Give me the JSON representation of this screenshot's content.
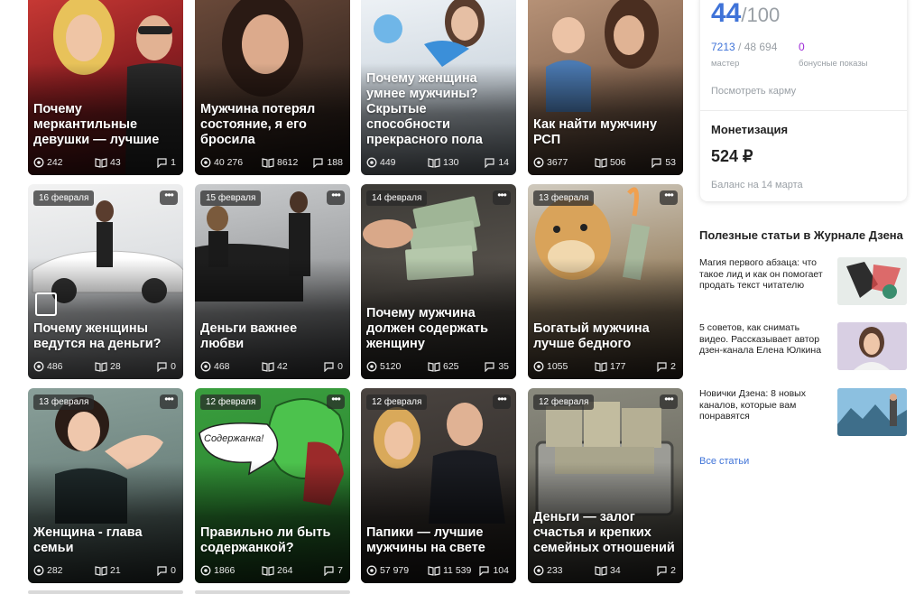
{
  "cards": [
    {
      "date": "",
      "title": "Почему меркантильные девушки — лучшие",
      "views": "242",
      "reads": "43",
      "comments": "1"
    },
    {
      "date": "",
      "title": "Мужчина потерял состояние, я его бросила",
      "views": "40 276",
      "reads": "8612",
      "comments": "188"
    },
    {
      "date": "",
      "title": "Почему женщина умнее мужчины? Скрытые способности прекрасного пола",
      "views": "449",
      "reads": "130",
      "comments": "14"
    },
    {
      "date": "",
      "title": "Как найти мужчину РСП",
      "views": "3677",
      "reads": "506",
      "comments": "53"
    },
    {
      "date": "16 февраля",
      "title": "Почему женщины ведутся на деньги?",
      "views": "486",
      "reads": "28",
      "comments": "0"
    },
    {
      "date": "15 февраля",
      "title": "Деньги важнее любви",
      "views": "468",
      "reads": "42",
      "comments": "0"
    },
    {
      "date": "14 февраля",
      "title": "Почему мужчина должен содержать женщину",
      "views": "5120",
      "reads": "625",
      "comments": "35"
    },
    {
      "date": "13 февраля",
      "title": "Богатый мужчина лучше бедного",
      "views": "1055",
      "reads": "177",
      "comments": "2"
    },
    {
      "date": "13 февраля",
      "title": "Женщина - глава семьи",
      "views": "282",
      "reads": "21",
      "comments": "0"
    },
    {
      "date": "12 февраля",
      "title": "Правильно ли быть содержанкой?",
      "views": "1866",
      "reads": "264",
      "comments": "7",
      "bubble": "Содержанка!"
    },
    {
      "date": "12 февраля",
      "title": "Папики — лучшие мужчины на свете",
      "views": "57 979",
      "reads": "11 539",
      "comments": "104"
    },
    {
      "date": "12 февраля",
      "title": "Деньги — залог счастья и крепких семейных отношений",
      "views": "233",
      "reads": "34",
      "comments": "2"
    }
  ],
  "sidebar": {
    "karma_value": "44",
    "karma_max": "/100",
    "master_value": "7213",
    "master_total": " / 48 694",
    "master_label": "мастер",
    "bonus_value": "0",
    "bonus_label": "бонусные показы",
    "karma_link": "Посмотреть карму",
    "monetization_title": "Монетизация",
    "monetization_value": "524 ₽",
    "balance_date": "Баланс на 14 марта"
  },
  "articles": {
    "title": "Полезные статьи в Журнале Дзена",
    "items": [
      {
        "text": "Магия первого абзаца: что такое лид и как он помогает продать текст читателю"
      },
      {
        "text": "5 советов, как снимать видео. Рассказывает автор дзен-канала Елена Юлкина"
      },
      {
        "text": "Новички Дзена: 8 новых каналов, которые вам понравятся"
      }
    ],
    "all_link": "Все статьи"
  },
  "colors": {
    "accent": "#3f73d8",
    "bonus": "#9c27d6",
    "muted": "#9aa0a6"
  }
}
